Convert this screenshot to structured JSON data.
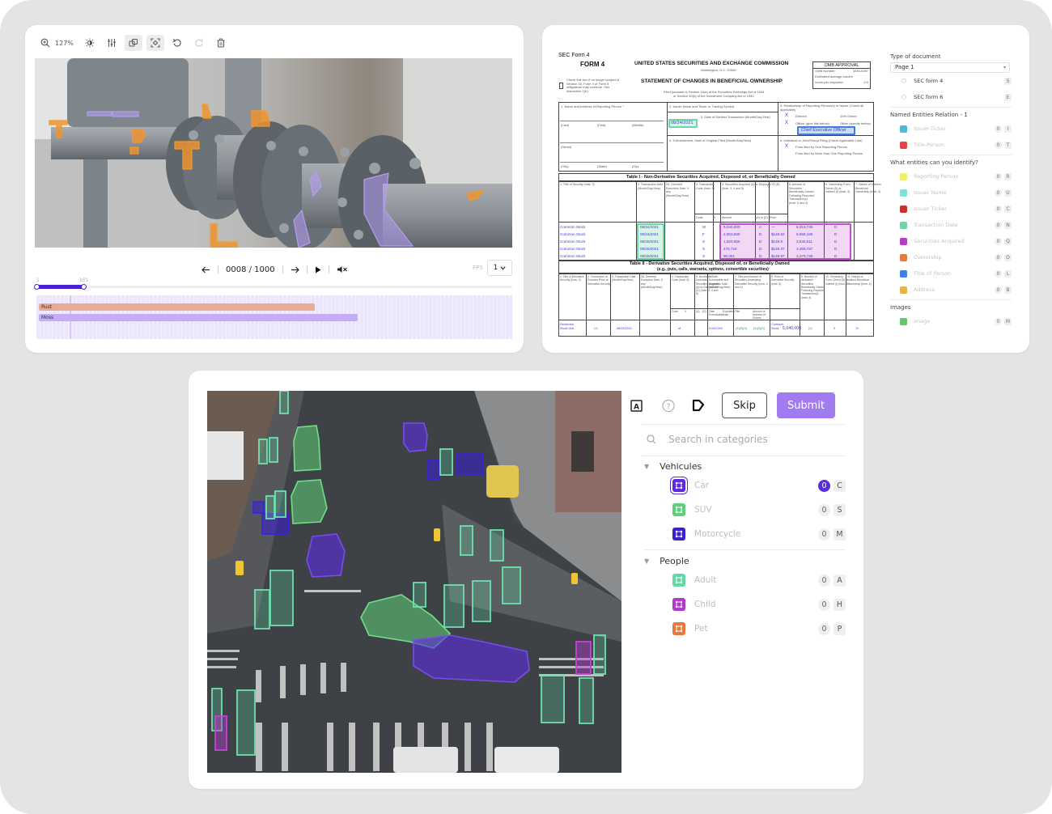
{
  "video_tool": {
    "toolbar": {
      "zoom_level": "127%",
      "tools": [
        {
          "name": "zoom-in-icon"
        },
        {
          "name": "brightness-icon"
        },
        {
          "name": "adjustments-icon"
        },
        {
          "name": "overlay-icon",
          "active": true
        },
        {
          "name": "focus-icon",
          "active": true
        },
        {
          "name": "undo-icon"
        },
        {
          "name": "redo-icon",
          "disabled": true
        },
        {
          "name": "delete-icon"
        }
      ]
    },
    "player": {
      "frame_counter": "0008 / 1000",
      "fps_label": "FPS",
      "fps_value": "1",
      "range_start": "1",
      "range_end": "101",
      "range_fill_fraction": 0.1,
      "cursor_fraction": 0.07
    },
    "tracks": [
      {
        "label": "Rust",
        "color": "#e9ab95",
        "end_fraction": 0.58
      },
      {
        "label": "Moss",
        "color": "#c3adf5",
        "end_fraction": 0.67
      }
    ],
    "colors": {
      "rust": "#f0922b",
      "moss": "#b79cf4",
      "accent": "#4a22d6"
    }
  },
  "document_tool": {
    "form": {
      "caption": "SEC Form 4",
      "form_title": "FORM 4",
      "agency": "UNITED STATES SECURITIES AND EXCHANGE COMMISSION",
      "agency_city": "Washington, D.C. 20549",
      "statement_title": "STATEMENT OF CHANGES IN BENEFICIAL OWNERSHIP",
      "filed_note_1": "Filed pursuant to Section 16(a) of the Securities Exchange Act of 1934",
      "filed_note_2": "or Section 30(h) of the Investment Company Act of 1940",
      "checkbox_note": "Check this box if no longer subject to Section 16. Form 4 or Form 5 obligations may continue. See Instruction 1(b).",
      "omb_title": "OMB APPROVAL",
      "omb_rows": [
        {
          "label": "OMB Number:",
          "value": "3235-0287"
        },
        {
          "label": "Estimated average burden",
          "value": ""
        },
        {
          "label": "hours per response:",
          "value": "0.5"
        }
      ],
      "box1_label": "1. Name and Address of Reporting Person *",
      "box1_fields": [
        "(Last)",
        "(First)",
        "(Middle)",
        "(Street)",
        "(City)",
        "(State)",
        "(Zip)"
      ],
      "box2_label": "2. Issuer Name and Ticker or Trading Symbol",
      "box3_label": "3. Date of Earliest Transaction (Month/Day/Year)",
      "box3_value": "08/24/2021",
      "box4_label": "4. If Amendment, Date of Original Filed (Month/Day/Year)",
      "box5_label": "5. Relationship of Reporting Person(s) to Issuer (Check all applicable)",
      "box5_options": [
        {
          "mark": "X",
          "label": "Director",
          "right": "10% Owner"
        },
        {
          "mark": "X",
          "label": "Officer (give title below)",
          "right": "Other (specify below)"
        }
      ],
      "officer_title": "Chief Executive Officer",
      "box6_label": "6. Individual or Joint/Group Filing (Check Applicable Line)",
      "box6_options": [
        {
          "mark": "X",
          "label": "Form filed by One Reporting Person"
        },
        {
          "mark": "",
          "label": "Form filed by More than One Reporting Person"
        }
      ],
      "table1_title": "Table I - Non-Derivative Securities Acquired, Disposed of, or Beneficially Owned",
      "table1_headers": [
        "1. Title of Security (Instr. 3)",
        "2. Transaction Date (Month/Day/Year)",
        "2A. Deemed Execution Date, if any (Month/Day/Year)",
        "3. Transaction Code (Instr. 8)",
        "4. Securities Acquired (A) or Disposed Of (D) (Instr. 3, 4 and 5)",
        "5. Amount of Securities Beneficially Owned Following Reported Transaction(s) (Instr. 3 and 4)",
        "6. Ownership Form: Direct (D) or Indirect (I) (Instr. 4)",
        "7. Nature of Indirect Beneficial Ownership (Instr. 4)"
      ],
      "table1_subheaders": [
        "Code",
        "V",
        "Amount",
        "(A) or (D)",
        "Price"
      ],
      "table1_rows": [
        {
          "title": "Common Stock",
          "date": "08/24/2021",
          "code": "M",
          "amount": "5,040,000",
          "ad": "A",
          "price": "—",
          "owned": "8,319,726",
          "form": "D"
        },
        {
          "title": "Common Stock",
          "date": "08/24/2021",
          "code": "F",
          "amount": "2,653,560",
          "ad": "D",
          "price": "$149.62",
          "owned": "5,666,166",
          "form": "D"
        },
        {
          "title": "Common Stock",
          "date": "08/25/2021",
          "code": "S",
          "amount": "1,820,655",
          "ad": "D",
          "price": "$148.9",
          "owned": "3,845,511",
          "form": "D"
        },
        {
          "title": "Common Stock",
          "date": "08/25/2021",
          "code": "S",
          "amount": "475,724",
          "ad": "D",
          "price": "$149.37",
          "owned": "3,369,787",
          "form": "D"
        },
        {
          "title": "Common Stock",
          "date": "08/25/2021",
          "code": "S",
          "amount": "90,061",
          "ad": "D",
          "price": "$149.97",
          "owned": "3,279,726",
          "form": "D"
        }
      ],
      "table2_title": "Table II - Derivative Securities Acquired, Disposed of, or Beneficially Owned",
      "table2_subtitle": "(e.g., puts, calls, warrants, options, convertible securities)",
      "table2_headers": [
        "1. Title of Derivative Security (Instr. 3)",
        "2. Conversion or Exercise Price of Derivative Security",
        "3. Transaction Date (Month/Day/Year)",
        "3A. Deemed Execution Date, if any (Month/Day/Year)",
        "4. Transaction Code (Instr. 8)",
        "5. Number of Derivative Securities Acquired (A) or Disposed of (D) (Instr. 3, 4 and 5)",
        "6. Date Exercisable and Expiration Date (Month/Day/Year)",
        "7. Title and Amount of Securities Underlying Derivative Security (Instr. 3 and 4)",
        "8. Price of Derivative Security (Instr. 5)",
        "9. Number of derivative Securities Beneficially Owned Following Reported Transaction(s) (Instr. 4)",
        "10. Ownership Form: Direct (D) or Indirect (I) (Instr. 4)",
        "11. Nature of Indirect Beneficial Ownership (Instr. 4)"
      ],
      "table2_subheaders": [
        "Code",
        "V",
        "(A)",
        "(D)",
        "Date Exercisable",
        "Expiration Date",
        "Title",
        "Amount or Number of Shares"
      ],
      "table2_row": {
        "title": "Restricted Stock Unit",
        "conv": "(4)",
        "date": "08/24/2021",
        "code": "M",
        "d": "5,040,000",
        "exercisable": "(4)(5)(6)",
        "expiration": "(4)(5)(6)",
        "u_title": "Common Stock",
        "u_amount": "5,040,000",
        "price": "(4)",
        "owned": "0",
        "form": "D"
      }
    },
    "panel": {
      "type_heading": "Type of document",
      "type_value": "Page 1",
      "type_options": [
        {
          "label": "SEC form 4",
          "key": "S"
        },
        {
          "label": "SEC form 6",
          "key": "E"
        }
      ],
      "ner_relation_heading": "Named Entities Relation - 1",
      "relations": [
        {
          "label": "Issuer-Ticker",
          "color": "#52b8d9",
          "count": "0",
          "key": "I"
        },
        {
          "label": "Title-Person",
          "color": "#e0464b",
          "count": "0",
          "key": "T"
        }
      ],
      "entities_heading": "What entities can you identify?",
      "entities": [
        {
          "label": "Reporting Person",
          "color": "#f1ee6b",
          "count": "0",
          "key": "R"
        },
        {
          "label": "Issuer Name",
          "color": "#7fe2d2",
          "count": "0",
          "key": "U"
        },
        {
          "label": "Issuer Ticker",
          "color": "#c2362c",
          "count": "0",
          "key": "C"
        },
        {
          "label": "Transaction Date",
          "color": "#72d3a8",
          "count": "0",
          "key": "N"
        },
        {
          "label": "Securities Acquired",
          "color": "#b43ec8",
          "count": "0",
          "key": "Q"
        },
        {
          "label": "Ownership",
          "color": "#e6793c",
          "count": "0",
          "key": "O"
        },
        {
          "label": "Title of Person",
          "color": "#3f7fe3",
          "count": "0",
          "key": "L"
        },
        {
          "label": "Address",
          "color": "#e8b44a",
          "count": "0",
          "key": "B"
        }
      ],
      "images_heading": "Images",
      "images": [
        {
          "label": "Image",
          "color": "#5ec96e",
          "count": "0",
          "key": "M"
        }
      ]
    }
  },
  "street_tool": {
    "toolbar": {
      "skip_label": "Skip",
      "submit_label": "Submit",
      "icons": [
        "label-a-icon",
        "help-icon",
        "tag-shape-icon"
      ]
    },
    "search": {
      "placeholder": "Search in categories"
    },
    "groups": [
      {
        "name": "Vehicules",
        "items": [
          {
            "label": "Car",
            "color": "#5b2be0",
            "count": "0",
            "key": "C",
            "active": true
          },
          {
            "label": "SUV",
            "color": "#5fcf79",
            "count": "0",
            "key": "S"
          },
          {
            "label": "Motorcycle",
            "color": "#3a22c7",
            "count": "0",
            "key": "M"
          }
        ]
      },
      {
        "name": "People",
        "items": [
          {
            "label": "Adult",
            "color": "#63d7a6",
            "count": "0",
            "key": "A"
          },
          {
            "label": "Child",
            "color": "#b23ac9",
            "count": "0",
            "key": "H"
          },
          {
            "label": "Pet",
            "color": "#e6793c",
            "count": "0",
            "key": "P"
          }
        ]
      }
    ]
  }
}
